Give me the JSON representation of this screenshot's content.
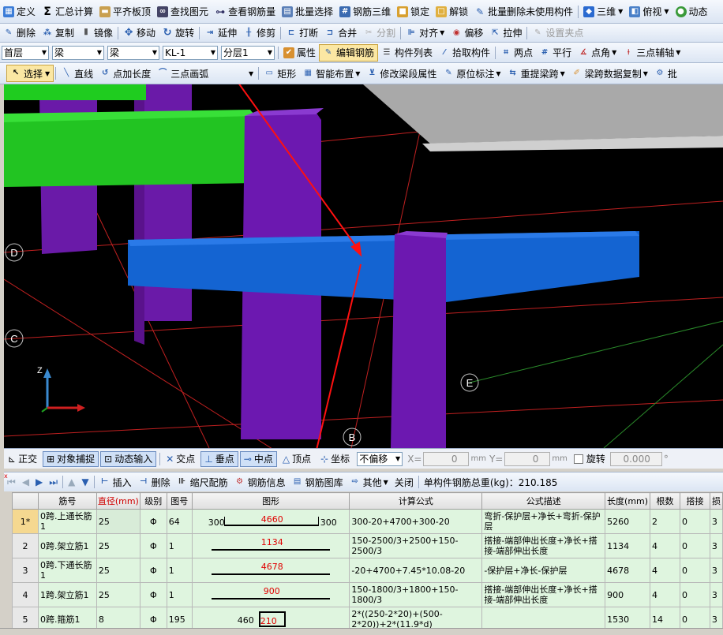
{
  "toolbar1": [
    "定义",
    "汇总计算",
    "平齐板顶",
    "查找图元",
    "查看钢筋量",
    "批量选择",
    "钢筋三维",
    "锁定",
    "解锁",
    "批量删除未使用构件",
    "三维",
    "俯视",
    "动态"
  ],
  "toolbar2": [
    "删除",
    "复制",
    "镜像",
    "移动",
    "旋转",
    "延伸",
    "修剪",
    "打断",
    "合并",
    "分割",
    "对齐",
    "偏移",
    "拉伸",
    "设置夹点"
  ],
  "toolbar3": {
    "floor": "首层",
    "cat1": "梁",
    "cat2": "梁",
    "comp": "KL-1",
    "layer": "分层1",
    "items": [
      "属性",
      "编辑钢筋",
      "构件列表",
      "拾取构件",
      "两点",
      "平行",
      "点角",
      "三点辅轴"
    ]
  },
  "toolbar4": [
    "选择",
    "直线",
    "点加长度",
    "三点画弧",
    "矩形",
    "智能布置",
    "修改梁段属性",
    "原位标注",
    "重提梁跨",
    "梁跨数据复制",
    "批"
  ],
  "axis_labels": {
    "d": "D",
    "c": "C",
    "e": "E",
    "b": "B"
  },
  "statusbar": {
    "items": [
      "正交",
      "对象捕捉",
      "动态输入",
      "交点",
      "垂点",
      "中点",
      "顶点",
      "坐标"
    ],
    "offset": "不偏移",
    "x_label": "X=",
    "y_label": "Y=",
    "x_val": "0",
    "y_val": "0",
    "unit": "mm",
    "rotate": "旋转",
    "rot_val": "0.000",
    "deg": "°"
  },
  "rebar_toolbar": {
    "items": [
      "插入",
      "删除",
      "缩尺配筋",
      "钢筋信息",
      "钢筋图库",
      "其他",
      "关闭"
    ],
    "total": "单构件钢筋总重(kg)：210.185"
  },
  "table": {
    "headers": [
      "筋号",
      "直径(mm)",
      "级别",
      "图号",
      "图形",
      "计算公式",
      "公式描述",
      "长度(mm)",
      "根数",
      "搭接",
      "损"
    ],
    "rows": [
      {
        "n": "1*",
        "name": "0跨.上通长筋1",
        "dia": "25",
        "grade": "Φ",
        "fig": "64",
        "shape_l": "300",
        "shape_m": "4660",
        "shape_r": "300",
        "formula": "300-20+4700+300-20",
        "desc": "弯折-保护层+净长+弯折-保护层",
        "len": "5260",
        "cnt": "2",
        "lap": "0",
        "loss": "3"
      },
      {
        "n": "2",
        "name": "0跨.架立筋1",
        "dia": "25",
        "grade": "Φ",
        "fig": "1",
        "shape_l": "",
        "shape_m": "1134",
        "shape_r": "",
        "formula": "150-2500/3+2500+150-2500/3",
        "desc": "搭接-端部伸出长度+净长+搭接-端部伸出长度",
        "len": "1134",
        "cnt": "4",
        "lap": "0",
        "loss": "3"
      },
      {
        "n": "3",
        "name": "0跨.下通长筋1",
        "dia": "25",
        "grade": "Φ",
        "fig": "1",
        "shape_l": "",
        "shape_m": "4678",
        "shape_r": "",
        "formula": "-20+4700+7.45*10.08-20",
        "desc": "-保护层+净长-保护层",
        "len": "4678",
        "cnt": "4",
        "lap": "0",
        "loss": "3"
      },
      {
        "n": "4",
        "name": "1跨.架立筋1",
        "dia": "25",
        "grade": "Φ",
        "fig": "1",
        "shape_l": "",
        "shape_m": "900",
        "shape_r": "",
        "formula": "150-1800/3+1800+150-1800/3",
        "desc": "搭接-端部伸出长度+净长+搭接-端部伸出长度",
        "len": "900",
        "cnt": "4",
        "lap": "0",
        "loss": "3"
      },
      {
        "n": "5",
        "name": "0跨.箍筋1",
        "dia": "8",
        "grade": "Φ",
        "fig": "195",
        "shape_l": "460",
        "shape_m": "210",
        "shape_r": "",
        "formula": "2*((250-2*20)+(500-2*20))+2*(11.9*d)",
        "desc": "",
        "len": "1530",
        "cnt": "14",
        "lap": "0",
        "loss": "3"
      }
    ]
  }
}
